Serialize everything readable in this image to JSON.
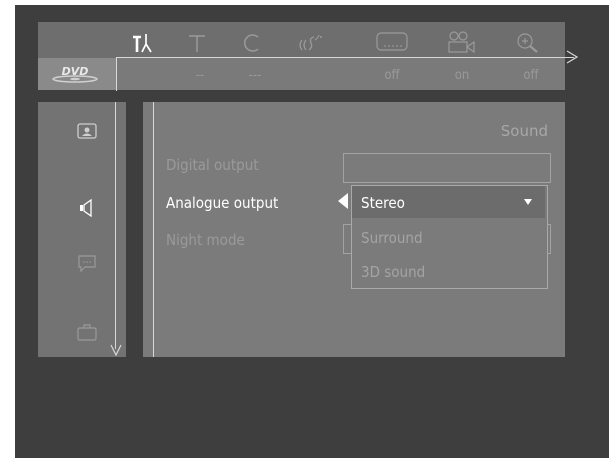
{
  "menu": {
    "tabs": [
      {
        "icon": "settings-tools-icon",
        "active": true
      },
      {
        "icon": "text-icon",
        "active": false
      },
      {
        "icon": "chapter-icon",
        "active": false
      },
      {
        "icon": "audio-language-icon",
        "active": false
      },
      {
        "icon": "subtitle-icon",
        "active": false
      },
      {
        "icon": "camera-angle-icon",
        "active": false
      },
      {
        "icon": "zoom-icon",
        "active": false
      }
    ]
  },
  "status": {
    "disc_logo": "DVD",
    "values": [
      "--",
      "---",
      "off",
      "on",
      "off"
    ]
  },
  "sidebar": {
    "items": [
      {
        "icon": "picture-settings-icon"
      },
      {
        "icon": "sound-settings-icon",
        "active": true
      },
      {
        "icon": "language-settings-icon"
      },
      {
        "icon": "features-settings-icon"
      }
    ]
  },
  "panel": {
    "title": "Sound",
    "rows": [
      {
        "label": "Digital output",
        "active": false
      },
      {
        "label": "Analogue output",
        "active": true
      },
      {
        "label": "Night mode",
        "active": false
      }
    ]
  },
  "dropdown": {
    "options": [
      "Stereo",
      "Surround",
      "3D sound"
    ],
    "selected": "Stereo"
  },
  "colors": {
    "background": "#3e3e3e",
    "active_text": "#ffffff",
    "inactive_text": "#9a9a9a"
  }
}
